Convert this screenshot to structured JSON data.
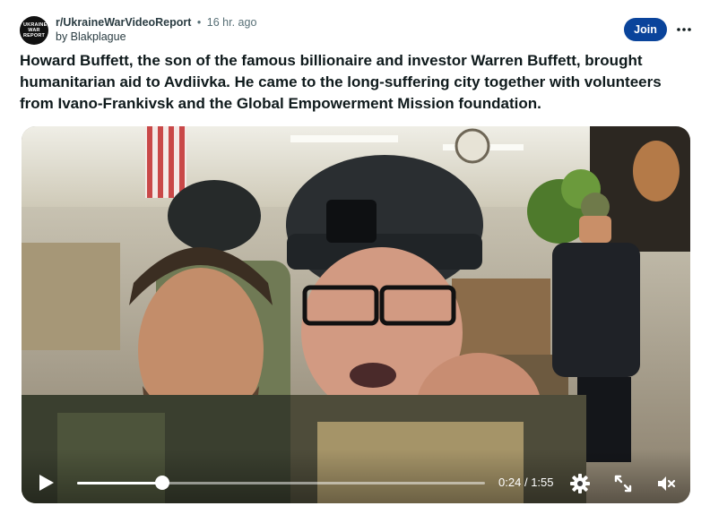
{
  "header": {
    "avatar_text": "UKRAINE WAR REPORT",
    "subreddit": "r/UkraineWarVideoReport",
    "separator": "•",
    "time_ago": "16 hr. ago",
    "byline": "by Blakplague",
    "join_label": "Join",
    "more_icon": "ellipsis-icon"
  },
  "post": {
    "title": "Howard Buffett, the son of the famous billionaire and investor Warren Buffett, brought humanitarian aid to Avdiivka. He came to the long-suffering city together with volunteers from Ivano-Frankivsk and the Global Empowerment Mission foundation."
  },
  "video": {
    "current_time": "0:24",
    "time_separator": "/",
    "duration": "1:55",
    "progress": 0.209,
    "icons": [
      "play-icon",
      "settings-gear-icon",
      "fullscreen-icon",
      "mute-icon"
    ]
  },
  "colors": {
    "join_button": "#0a449b",
    "meta_text": "#576f76",
    "title_text": "#0f1a1c"
  }
}
